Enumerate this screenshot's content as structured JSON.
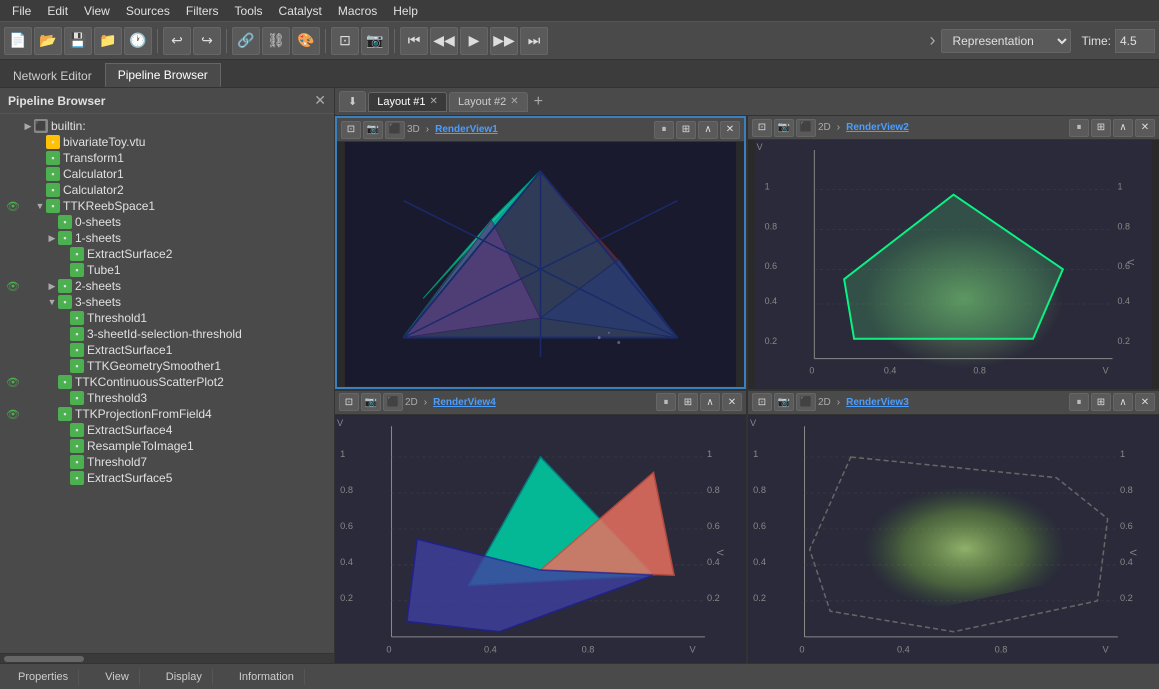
{
  "menubar": {
    "items": [
      "File",
      "Edit",
      "View",
      "Sources",
      "Filters",
      "Tools",
      "Catalyst",
      "Macros",
      "Help"
    ]
  },
  "toolbar": {
    "representation_label": "Representation",
    "time_label": "Time:",
    "time_value": "4.5"
  },
  "tabs": {
    "network_editor": "Network Editor",
    "pipeline_browser": "Pipeline Browser"
  },
  "sidebar": {
    "title": "Pipeline Browser",
    "items": [
      {
        "id": "builtin",
        "label": "builtin:",
        "level": 0,
        "icon": "gray",
        "toggle": "",
        "visible": false
      },
      {
        "id": "bivariate",
        "label": "bivariateToy.vtu",
        "level": 1,
        "icon": "yellow",
        "toggle": "",
        "visible": false
      },
      {
        "id": "transform1",
        "label": "Transform1",
        "level": 1,
        "icon": "green",
        "toggle": "",
        "visible": false
      },
      {
        "id": "calculator1",
        "label": "Calculator1",
        "level": 1,
        "icon": "green",
        "toggle": "",
        "visible": false
      },
      {
        "id": "calculator2",
        "label": "Calculator2",
        "level": 1,
        "icon": "green",
        "toggle": "",
        "visible": false
      },
      {
        "id": "ttkreebspace1",
        "label": "TTKReebSpace1",
        "level": 1,
        "icon": "green",
        "toggle": "▼",
        "visible": true
      },
      {
        "id": "0sheets",
        "label": "0-sheets",
        "level": 2,
        "icon": "green",
        "toggle": "",
        "visible": false
      },
      {
        "id": "1sheets",
        "label": "1-sheets",
        "level": 2,
        "icon": "green",
        "toggle": "▶",
        "visible": false
      },
      {
        "id": "extractsurface2",
        "label": "ExtractSurface2",
        "level": 3,
        "icon": "green",
        "toggle": "",
        "visible": false
      },
      {
        "id": "tube1",
        "label": "Tube1",
        "level": 3,
        "icon": "green",
        "toggle": "",
        "visible": false
      },
      {
        "id": "2sheets",
        "label": "2-sheets",
        "level": 2,
        "icon": "green",
        "toggle": "▶",
        "visible": true
      },
      {
        "id": "3sheets",
        "label": "3-sheets",
        "level": 2,
        "icon": "green",
        "toggle": "▼",
        "visible": false
      },
      {
        "id": "threshold1",
        "label": "Threshold1",
        "level": 3,
        "icon": "green",
        "toggle": "",
        "visible": false
      },
      {
        "id": "3sheetid",
        "label": "3-sheetId-selection-threshold",
        "level": 3,
        "icon": "green",
        "toggle": "",
        "visible": false
      },
      {
        "id": "extractsurface1",
        "label": "ExtractSurface1",
        "level": 3,
        "icon": "green",
        "toggle": "",
        "visible": false
      },
      {
        "id": "ttkgeo",
        "label": "TTKGeometrySmoother1",
        "level": 3,
        "icon": "green",
        "toggle": "",
        "visible": false
      },
      {
        "id": "ttkcont",
        "label": "TTKContinuousScatterPlot2",
        "level": 2,
        "icon": "green",
        "toggle": "",
        "visible": false
      },
      {
        "id": "threshold3",
        "label": "Threshold3",
        "level": 3,
        "icon": "green",
        "toggle": "",
        "visible": false
      },
      {
        "id": "ttkproj",
        "label": "TTKProjectionFromField4",
        "level": 2,
        "icon": "green",
        "toggle": "",
        "visible": false
      },
      {
        "id": "extractsurface4",
        "label": "ExtractSurface4",
        "level": 3,
        "icon": "green",
        "toggle": "",
        "visible": false
      },
      {
        "id": "resample",
        "label": "ResampleToImage1",
        "level": 3,
        "icon": "green",
        "toggle": "",
        "visible": false
      },
      {
        "id": "threshold7",
        "label": "Threshold7",
        "level": 3,
        "icon": "green",
        "toggle": "",
        "visible": false
      },
      {
        "id": "extractsurface5",
        "label": "ExtractSurface5",
        "level": 3,
        "icon": "green",
        "toggle": "",
        "visible": false
      }
    ]
  },
  "layouts": {
    "tabs": [
      {
        "label": "Layout #1",
        "active": true
      },
      {
        "label": "Layout #2",
        "active": false
      }
    ],
    "add_label": "+"
  },
  "views": [
    {
      "id": "renderview1",
      "label": "RenderView1",
      "dim": "3D",
      "active": true,
      "position": "top-left"
    },
    {
      "id": "renderview2",
      "label": "RenderView2",
      "dim": "",
      "active": false,
      "position": "top-right"
    },
    {
      "id": "renderview4",
      "label": "RenderView4",
      "dim": "2D",
      "active": false,
      "position": "bottom-left"
    },
    {
      "id": "renderview3",
      "label": "RenderView3",
      "dim": "2D",
      "active": false,
      "position": "bottom-right"
    }
  ],
  "statusbar": {
    "tabs": [
      "Properties",
      "View",
      "Display",
      "Information"
    ]
  }
}
